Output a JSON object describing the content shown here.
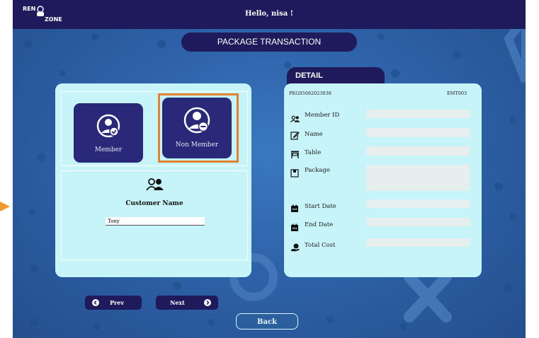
{
  "header": {
    "logo_line1": "REN",
    "logo_line2": "ZONE",
    "greeting": "Hello, nisa !"
  },
  "page_title": "PACKAGE TRANSACTION",
  "customer_type": {
    "options": [
      {
        "label": "Member",
        "icon": "user-check-icon"
      },
      {
        "label": "Non Member",
        "icon": "user-minus-icon",
        "selected": true
      }
    ]
  },
  "customer": {
    "label": "Customer Name",
    "name_value": "Tony",
    "icon": "users-icon"
  },
  "navigation": {
    "prev_label": "Prev",
    "next_label": "Next"
  },
  "detail": {
    "title": "DETAIL",
    "transaction_id": "PKG05082023038",
    "employee_id": "EMT003",
    "fields": [
      {
        "label": "Member ID",
        "icon": "users-icon",
        "value": ""
      },
      {
        "label": "Name",
        "icon": "edit-icon",
        "value": ""
      },
      {
        "label": "Table",
        "icon": "table-icon",
        "value": ""
      },
      {
        "label": "Package",
        "icon": "package-icon",
        "value": ""
      },
      {
        "label": "Start Date",
        "icon": "calendar-icon",
        "value": ""
      },
      {
        "label": "End Date",
        "icon": "calendar-icon",
        "value": ""
      },
      {
        "label": "Total Cost",
        "icon": "cost-icon",
        "value": ""
      }
    ]
  },
  "back_label": "Back",
  "colors": {
    "header_bg": "#1f1a5c",
    "panel_bg": "#c6f4f8",
    "card_bg": "#2a2878",
    "highlight": "#e3812e"
  }
}
